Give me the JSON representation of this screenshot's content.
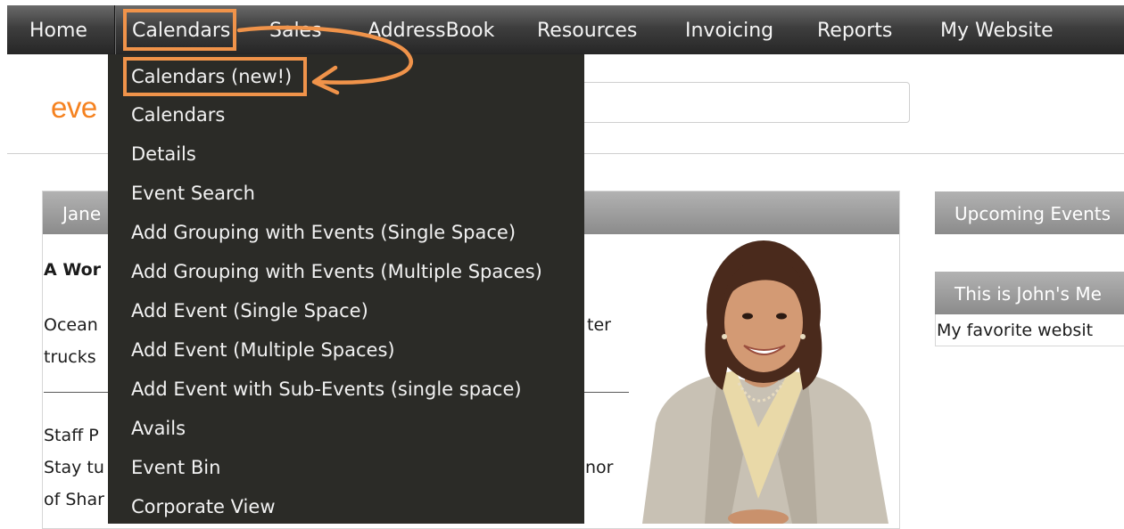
{
  "nav": {
    "items": [
      "Home",
      "Calendars",
      "Sales",
      "AddressBook",
      "Resources",
      "Invoicing",
      "Reports",
      "My Website"
    ]
  },
  "dropdown": {
    "items": [
      "Calendars (new!)",
      "Calendars",
      "Details",
      "Event Search",
      "Add Grouping with Events (Single Space)",
      "Add Grouping with Events (Multiple Spaces)",
      "Add Event (Single Space)",
      "Add Event (Multiple Spaces)",
      "Add Event with Sub-Events (single space)",
      "Avails",
      "Event Bin",
      "Corporate View"
    ]
  },
  "logo": {
    "text": "eve"
  },
  "main_panel": {
    "header": "Jane",
    "heading": "A Wor",
    "para1_line1_start": "Ocean",
    "para1_line1_end": "ter",
    "para1_line2_start": "trucks",
    "staff_line1": "Staff P",
    "staff_line2_start": "Stay tu",
    "staff_line2_end": "nor",
    "staff_line3": "of Shar"
  },
  "right_panels": {
    "upcoming_header": "Upcoming Events",
    "johns_header": "This is John's Me",
    "johns_text": "My favorite websit"
  },
  "colors": {
    "accent_annotation": "#f0934a",
    "logo_orange": "#f58220",
    "menu_bg": "#2b2b27"
  }
}
